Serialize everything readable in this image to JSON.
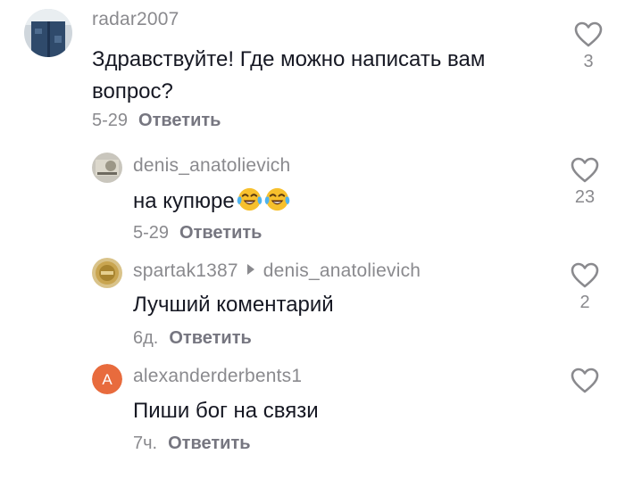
{
  "comments": [
    {
      "username": "radar2007",
      "text_line1": "Здравствуйте! Где можно написать вам",
      "text_line2": "вопрос?",
      "date": "5-29",
      "reply_label": "Ответить",
      "likes": "3"
    },
    {
      "username": "denis_anatolievich",
      "text": "на купюре",
      "emoji": [
        "face-with-tears-of-joy",
        "face-with-tears-of-joy"
      ],
      "date": "5-29",
      "reply_label": "Ответить",
      "likes": "23"
    },
    {
      "username": "spartak1387",
      "reply_to": "denis_anatolievich",
      "text": "Лучший коментарий",
      "date": "6д.",
      "reply_label": "Ответить",
      "likes": "2"
    },
    {
      "username": "alexanderderbents1",
      "avatar_letter": "A",
      "avatar_color": "#e86b3d",
      "text": "Пиши бог на связи",
      "date": "7ч.",
      "reply_label": "Ответить",
      "likes": ""
    }
  ]
}
